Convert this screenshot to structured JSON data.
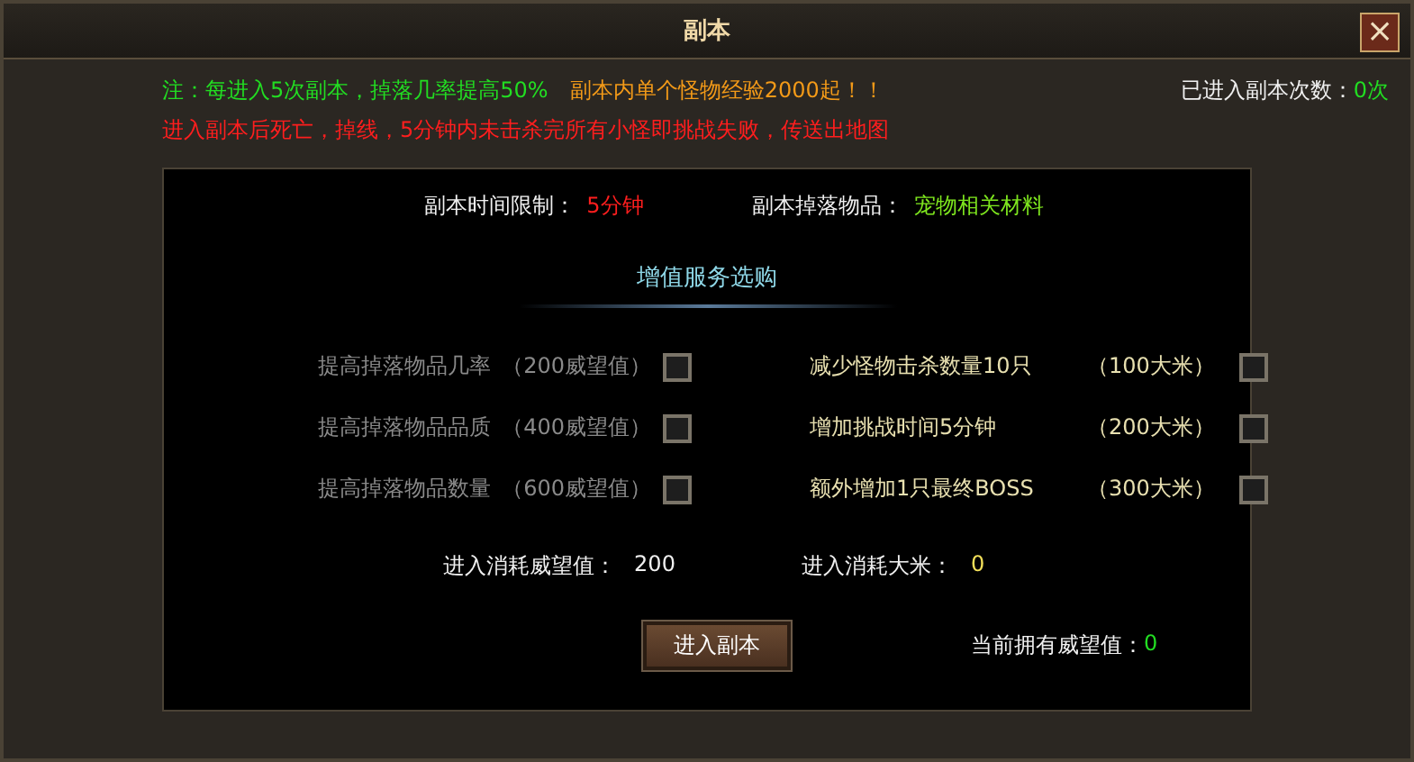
{
  "window": {
    "title": "副本",
    "close": "×"
  },
  "notice": {
    "bonus": "注：每进入5次副本，掉落几率提高50%",
    "exp": "副本内单个怪物经验2000起！！",
    "warning": "进入副本后死亡，掉线，5分钟内未击杀完所有小怪即挑战失败，传送出地图"
  },
  "entry_count": {
    "label": "已进入副本次数：",
    "value": "0次"
  },
  "info": [
    {
      "label": "副本时间限制：",
      "value": "5分钟",
      "kind": "time"
    },
    {
      "label": "副本掉落物品：",
      "value": "宠物相关材料",
      "kind": "reward"
    }
  ],
  "section_title": "增值服务选购",
  "options": [
    {
      "name": "提高掉落物品几率",
      "cost": "（200威望值）",
      "checked": false,
      "disabled": true
    },
    {
      "name": "减少怪物击杀数量10只",
      "cost": "（100大米）",
      "checked": false,
      "disabled": false
    },
    {
      "name": "提高掉落物品品质",
      "cost": "（400威望值）",
      "checked": false,
      "disabled": true
    },
    {
      "name": "增加挑战时间5分钟",
      "cost": "（200大米）",
      "checked": false,
      "disabled": false
    },
    {
      "name": "提高掉落物品数量",
      "cost": "（600威望值）",
      "checked": false,
      "disabled": true
    },
    {
      "name": "额外增加1只最终BOSS",
      "cost": "（300大米）",
      "checked": false,
      "disabled": false
    }
  ],
  "costs": [
    {
      "label": "进入消耗威望值：",
      "value": "200",
      "kind": "prestige"
    },
    {
      "label": "进入消耗大米：",
      "value": "0",
      "kind": "rice"
    }
  ],
  "enter_button": "进入副本",
  "current_prestige": {
    "label": "当前拥有威望值：",
    "value": "0"
  }
}
